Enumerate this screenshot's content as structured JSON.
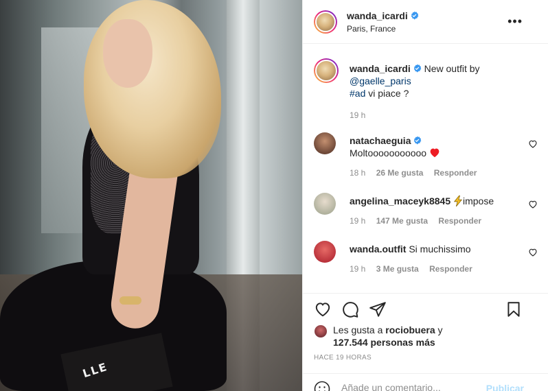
{
  "header": {
    "username": "wanda_icardi",
    "location": "Paris, France",
    "more_label": "•••"
  },
  "photo": {
    "bag_text": "LLE"
  },
  "caption": {
    "username": "wanda_icardi",
    "text": "New outfit by",
    "mention": "@gaelle_paris",
    "hashtag": "#ad",
    "rest": "vi piace ?",
    "time": "19 h"
  },
  "comments": [
    {
      "username": "natachaeguia",
      "text": "Moltooooooooooo",
      "emoji": "heart",
      "time": "18 h",
      "likes": "26 Me gusta",
      "reply": "Responder"
    },
    {
      "username": "angelina_maceyk8845",
      "text": "impose",
      "emoji": "lightning",
      "time": "19 h",
      "likes": "147 Me gusta",
      "reply": "Responder"
    },
    {
      "username": "wanda.outfit",
      "text": "Si muchissimo",
      "time": "19 h",
      "likes": "3 Me gusta",
      "reply": "Responder"
    }
  ],
  "likes": {
    "prefix": "Les gusta a",
    "user": "rociobuera",
    "connector": "y",
    "count": "127.544 personas más"
  },
  "timestamp": "HACE 19 HORAS",
  "add_comment": {
    "placeholder": "Añade un comentario...",
    "publish": "Publicar"
  },
  "colors": {
    "verified": "#3897f0",
    "link": "#00376b",
    "heart_red": "#ed4956",
    "muted": "#8e8e8e",
    "publish_disabled": "#b2dffc"
  }
}
